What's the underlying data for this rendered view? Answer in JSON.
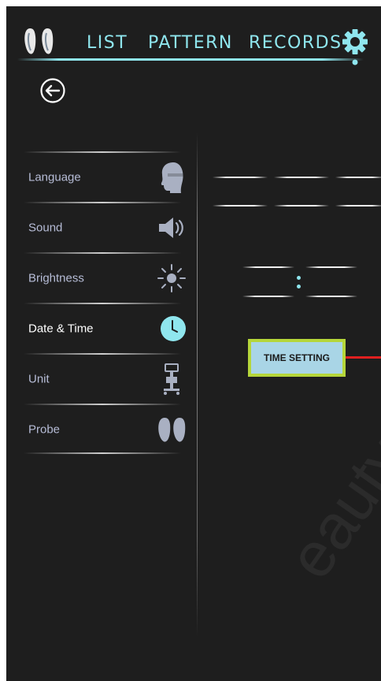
{
  "header": {
    "tabs": [
      {
        "label": "LIST"
      },
      {
        "label": "PATTERN"
      },
      {
        "label": "RECORDS"
      }
    ]
  },
  "sidebar": {
    "items": [
      {
        "label": "Language",
        "icon": "head-silhouette-icon"
      },
      {
        "label": "Sound",
        "icon": "speaker-icon"
      },
      {
        "label": "Brightness",
        "icon": "sun-icon"
      },
      {
        "label": "Date & Time",
        "icon": "clock-icon",
        "active": true
      },
      {
        "label": "Unit",
        "icon": "device-cart-icon"
      },
      {
        "label": "Probe",
        "icon": "probes-icon"
      }
    ]
  },
  "annotation": {
    "label": "TIME SETTING",
    "fill": "#a9d5e6",
    "border": "#b5d63a",
    "pointer": "#e02020"
  },
  "theme": {
    "background": "#1e1e1e",
    "accent": "#8fe6ee",
    "menu_text": "#b6bcd6"
  }
}
